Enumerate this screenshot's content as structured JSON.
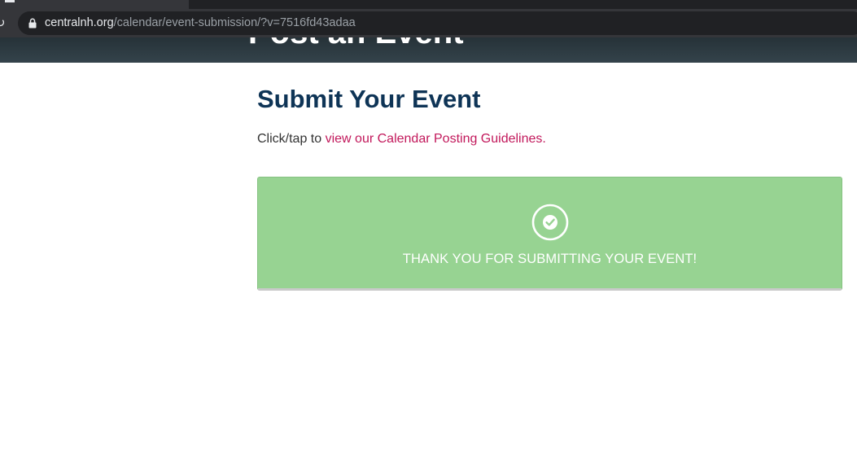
{
  "browser": {
    "url_host": "centralnh.org",
    "url_path": "/calendar/event-submission/?v=7516fd43adaa",
    "icons": {
      "reload": "reload-icon",
      "lock": "lock-icon"
    }
  },
  "hero": {
    "title": "Post an Event"
  },
  "main": {
    "heading": "Submit Your Event",
    "intro_text": "Click/tap to ",
    "guidelines_link": "view our Calendar Posting Guidelines.",
    "success_message": "THANK YOU FOR SUBMITTING YOUR EVENT!",
    "success_icon": "check-circle-icon"
  },
  "colors": {
    "heading": "#0e3456",
    "link": "#c2185b",
    "success_bg": "#97d392",
    "hero_bg": "#263238"
  }
}
